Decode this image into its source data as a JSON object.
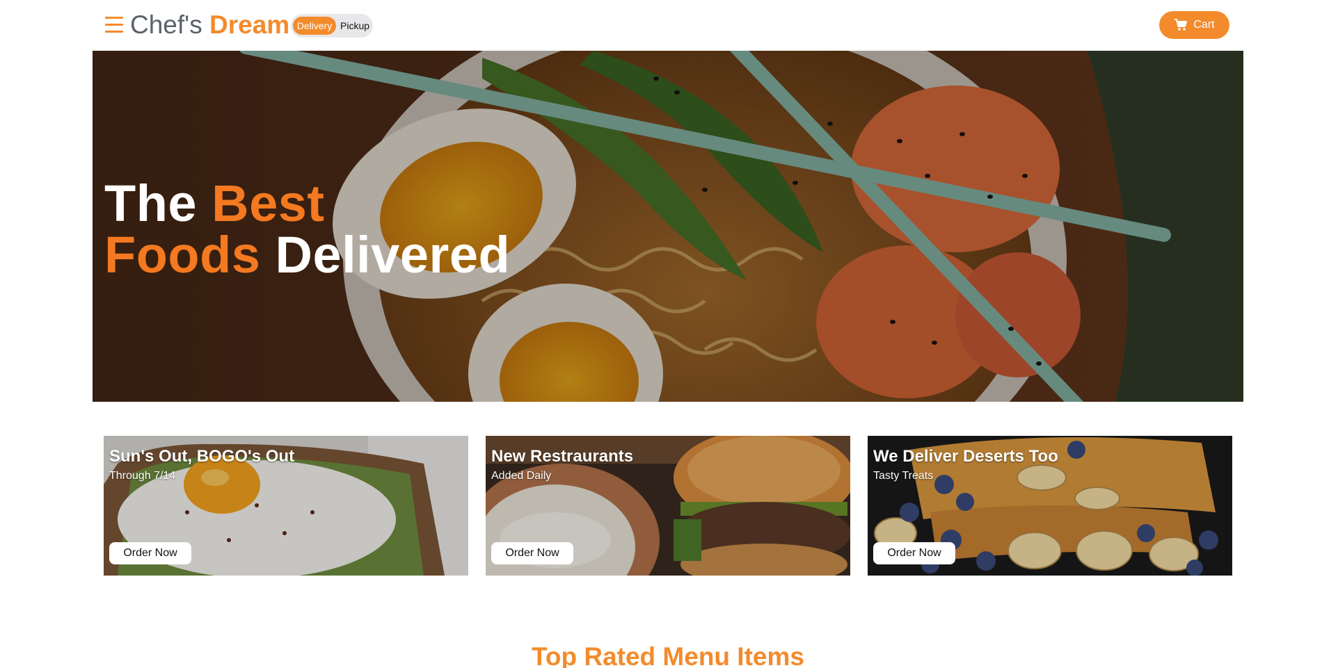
{
  "header": {
    "brand_part1": "Chef's",
    "brand_part2": "Dream",
    "menu_icon": "hamburger-menu-icon",
    "mode_toggle": {
      "selected": "Delivery",
      "options": [
        "Delivery",
        "Pickup"
      ]
    },
    "cart_label": "Cart",
    "cart_icon": "shopping-cart-icon"
  },
  "hero": {
    "title_word1": "The",
    "title_word2": "Best",
    "title_word3": "Foods",
    "title_word4": "Delivered",
    "image": "ramen-bowl-with-eggs-shrimp-chopsticks"
  },
  "promos": [
    {
      "title": "Sun's Out, BOGO's Out",
      "subtitle": "Through 7/14",
      "button": "Order Now",
      "image": "fried-egg-avocado-toast"
    },
    {
      "title": "New Restraurants",
      "subtitle": "Added Daily",
      "button": "Order Now",
      "image": "burger-and-dip"
    },
    {
      "title": "We Deliver Deserts Too",
      "subtitle": "Tasty Treats",
      "button": "Order Now",
      "image": "french-toast-bananas-blueberries"
    }
  ],
  "section": {
    "title": "Top Rated Menu Items"
  },
  "colors": {
    "accent": "#f38b2c",
    "hero_accent": "#f47920",
    "brand_gray": "#5b6169",
    "toggle_bg": "#e8e8ea"
  }
}
